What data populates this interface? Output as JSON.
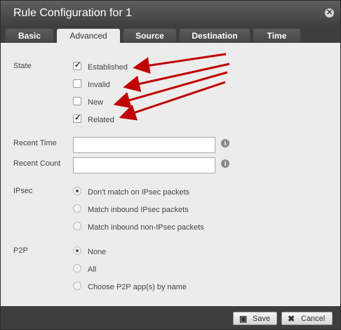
{
  "dialog": {
    "title": "Rule Configuration for 1",
    "close_icon": "close-icon"
  },
  "tabs": [
    {
      "label": "Basic",
      "active": false
    },
    {
      "label": "Advanced",
      "active": true
    },
    {
      "label": "Source",
      "active": false
    },
    {
      "label": "Destination",
      "active": false
    },
    {
      "label": "Time",
      "active": false
    }
  ],
  "state": {
    "label": "State",
    "options": [
      {
        "label": "Established",
        "checked": true
      },
      {
        "label": "Invalid",
        "checked": false
      },
      {
        "label": "New",
        "checked": false
      },
      {
        "label": "Related",
        "checked": true
      }
    ]
  },
  "recent_time": {
    "label": "Recent Time",
    "value": ""
  },
  "recent_count": {
    "label": "Recent Count",
    "value": ""
  },
  "ipsec": {
    "label": "IPsec",
    "options": [
      {
        "label": "Don't match on IPsec packets",
        "selected": true
      },
      {
        "label": "Match inbound IPsec packets",
        "selected": false
      },
      {
        "label": "Match inbound non-IPsec packets",
        "selected": false
      }
    ]
  },
  "p2p": {
    "label": "P2P",
    "options": [
      {
        "label": "None",
        "selected": true
      },
      {
        "label": "All",
        "selected": false
      },
      {
        "label": "Choose P2P app(s) by name",
        "selected": false
      }
    ]
  },
  "footer": {
    "save_label": "Save",
    "cancel_label": "Cancel"
  },
  "colors": {
    "titlebar": "#4a4a4a",
    "panel": "#ececec",
    "annotation_arrow": "#c00000"
  }
}
